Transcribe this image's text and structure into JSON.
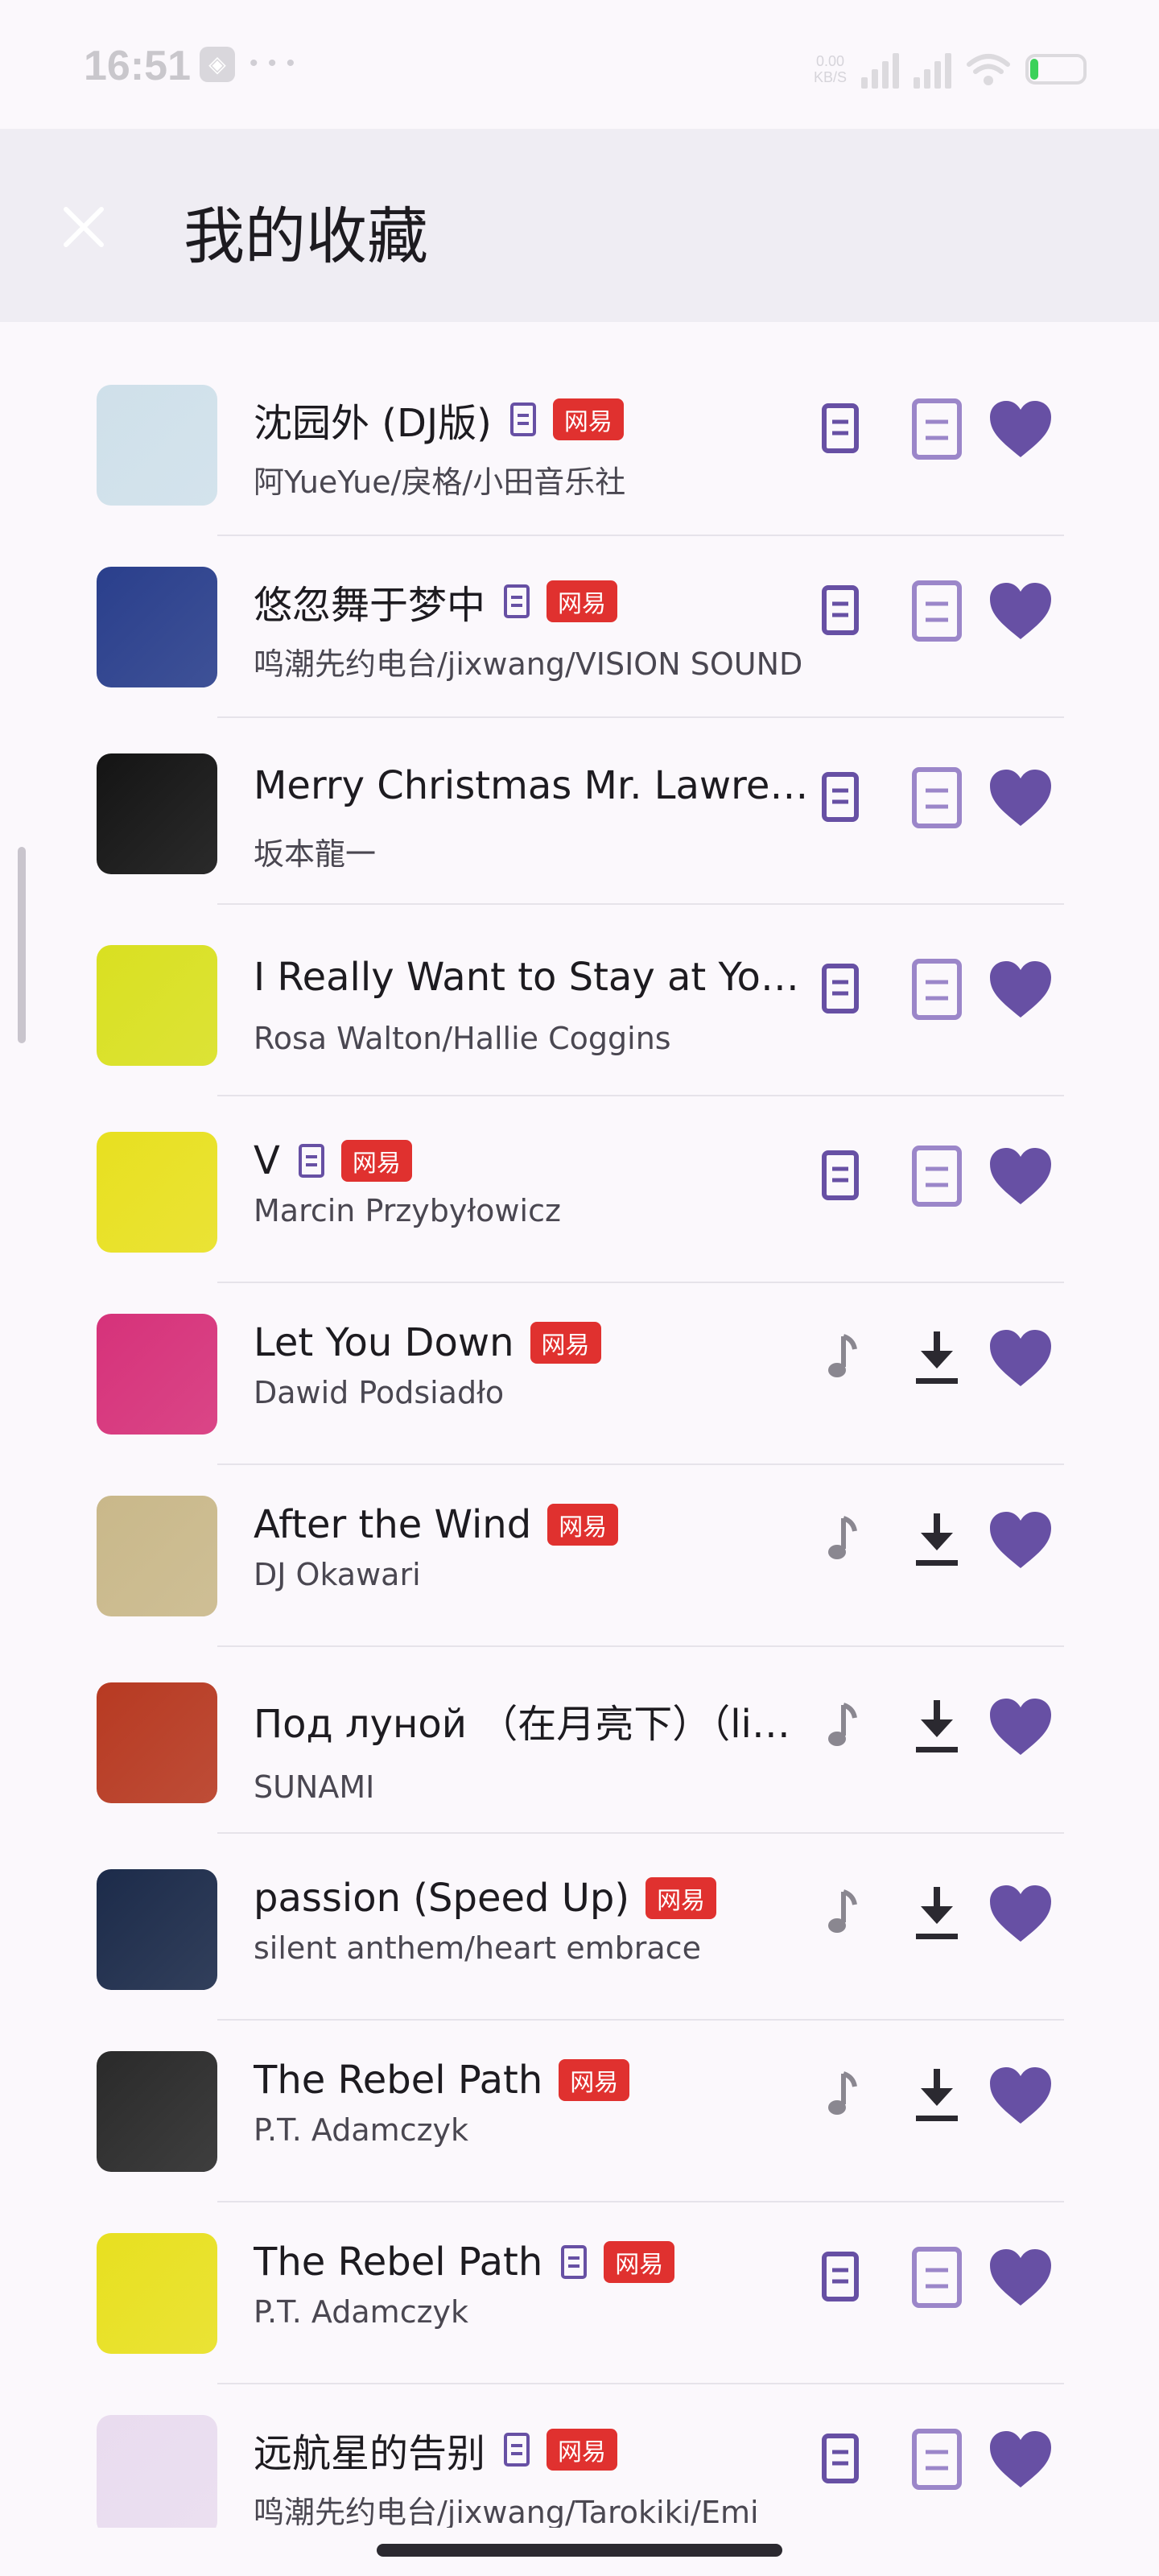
{
  "status_bar": {
    "time": "16:51",
    "app_icon": "app-notification-icon",
    "extra": "• • •",
    "net_speed_top": "0.00",
    "net_speed_bottom": "KB/S",
    "battery_level": 0.1
  },
  "header": {
    "title": "我的收藏",
    "close_icon": "close-icon"
  },
  "colors": {
    "accent": "#6750a4",
    "accent_light": "#9b86c9",
    "badge_red": "#e0312f",
    "header_bg": "#efedf3"
  },
  "songs": [
    {
      "title": "沈园外 (DJ版)",
      "artist": "阿YueYue/戾格/小田音乐社",
      "lyric_tag": true,
      "badge": "网易",
      "action": "lyrics",
      "cover": "#cfe0ea"
    },
    {
      "title": "悠忽舞于梦中",
      "artist": "鸣潮先约电台/jixwang/VISION SOUND",
      "lyric_tag": true,
      "badge": "网易",
      "action": "lyrics",
      "cover": "#2a3f8c"
    },
    {
      "title": "Merry Christmas Mr. Lawrence",
      "artist": "坂本龍一",
      "lyric_tag": false,
      "badge": "",
      "action": "lyrics",
      "cover": "#141414"
    },
    {
      "title": "I Really Want to Stay at Your House",
      "artist": "Rosa Walton/Hallie Coggins",
      "lyric_tag": false,
      "badge": "",
      "action": "lyrics",
      "cover": "#d9e021"
    },
    {
      "title": "V",
      "artist": "Marcin Przybyłowicz",
      "lyric_tag": true,
      "badge": "网易",
      "action": "lyrics",
      "cover": "#e8e020"
    },
    {
      "title": "Let You Down",
      "artist": "Dawid Podsiadło",
      "lyric_tag": false,
      "badge": "网易",
      "action": "download",
      "cover": "#d6327a"
    },
    {
      "title": "After the Wind",
      "artist": "DJ Okawari",
      "lyric_tag": false,
      "badge": "网易",
      "action": "download",
      "cover": "#c9b88a"
    },
    {
      "title": "Под луной （在月亮下）（live）",
      "artist": "SUNAMI",
      "lyric_tag": false,
      "badge": "",
      "action": "download",
      "cover": "#b73a22"
    },
    {
      "title": "passion (Speed Up)",
      "artist": "silent anthem/heart embrace",
      "lyric_tag": false,
      "badge": "网易",
      "action": "download",
      "cover": "#1c2b4a"
    },
    {
      "title": "The Rebel Path",
      "artist": "P.T. Adamczyk",
      "lyric_tag": false,
      "badge": "网易",
      "action": "download",
      "cover": "#2a2a2a"
    },
    {
      "title": "The Rebel Path",
      "artist": "P.T. Adamczyk",
      "lyric_tag": true,
      "badge": "网易",
      "action": "lyrics",
      "cover": "#e8e020"
    },
    {
      "title": "远航星的告别",
      "artist": "鸣潮先约电台/jixwang/Tarokiki/Emi",
      "lyric_tag": true,
      "badge": "网易",
      "action": "lyrics",
      "cover": "#e9dcef"
    }
  ]
}
